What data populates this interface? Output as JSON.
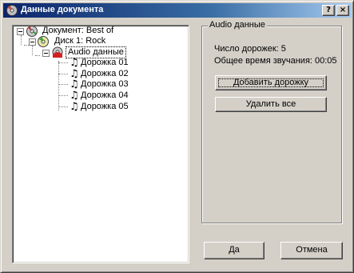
{
  "window": {
    "title": "Данные документа",
    "help_button": "?",
    "close_button": "×"
  },
  "tree": {
    "document": {
      "label": "Документ: Best of",
      "icon": "document-icon"
    },
    "disc": {
      "label": "Диск 1: Rock",
      "icon": "disc-icon"
    },
    "audio": {
      "label": "Audio данные",
      "icon": "audio-data-icon",
      "selected": true
    },
    "tracks": [
      {
        "label": "Дорожка 01",
        "icon": "music-note-icon"
      },
      {
        "label": "Дорожка 02",
        "icon": "music-note-icon"
      },
      {
        "label": "Дорожка 03",
        "icon": "music-note-icon"
      },
      {
        "label": "Дорожка 04",
        "icon": "music-note-icon"
      },
      {
        "label": "Дорожка 05",
        "icon": "music-note-icon"
      }
    ]
  },
  "details": {
    "group_title": "Audio данные",
    "track_count_label": "Число дорожек: 5",
    "total_time_label": "Общее время звучания: 00:05",
    "add_track_button": "Добавить дорожку",
    "delete_all_button": "Удалить все"
  },
  "footer": {
    "ok_button": "Да",
    "cancel_button": "Отмена"
  }
}
